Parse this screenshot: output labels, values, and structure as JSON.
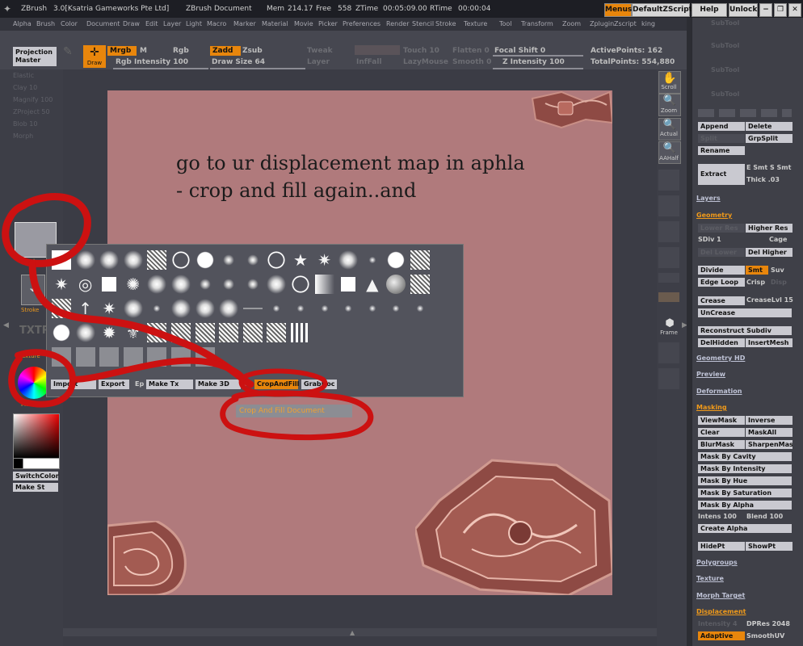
{
  "titlebar": {
    "app": "ZBrush",
    "version": "3.0[Ksatria Gameworks Pte Ltd]",
    "doc": "ZBrush Document",
    "mem_label": "Mem",
    "mem": "214.17",
    "free_label": "Free",
    "free": "558",
    "ztime_label": "ZTime",
    "ztime": "00:05:09.00",
    "rtime_label": "RTime",
    "rtime": "00:00:04",
    "menus": "Menus",
    "default_zscript": "DefaultZScript",
    "help": "Help",
    "unlock": "Unlock"
  },
  "menubar": [
    "Alpha",
    "Brush",
    "Color",
    "Document",
    "Draw",
    "Edit",
    "Layer",
    "Light",
    "Macro",
    "Marker",
    "Material",
    "Movie",
    "Picker",
    "Preferences",
    "Render",
    "Stencil",
    "Stroke",
    "Texture",
    "Tool",
    "Transform",
    "Zoom",
    "Zplugin",
    "Zscript",
    "king"
  ],
  "toolbar": {
    "projection_master": "Projection Master",
    "draw": "Draw",
    "mrgb": "Mrgb",
    "m": "M",
    "rgb": "Rgb",
    "rgb_intensity": "Rgb Intensity 100",
    "zadd": "Zadd",
    "zsub": "Zsub",
    "draw_size": "Draw Size 64",
    "focal_shift": "Focal Shift 0",
    "z_intensity": "Z Intensity 100",
    "active_points": "ActivePoints: 162",
    "total_points": "TotalPoints: 554,880",
    "dim1": "Tweak",
    "dim2": "Layer",
    "dim3": "InfFall",
    "dim4": "Touch 10",
    "dim5": "LazyMouse",
    "dim6": "Flatten 0",
    "dim7": "Smooth 0"
  },
  "left_shelf": {
    "sliders": [
      "Elastic",
      "Clay 10",
      "Magnify 100",
      "ZProject 50",
      "Blob 10",
      "Morph"
    ],
    "alpha_label": "Alpha",
    "stroke_label": "Stroke",
    "texture_label": "Texture",
    "material_label": "Material",
    "switch_color": "SwitchColor",
    "make_st": "Make St"
  },
  "canvas": {
    "line1": "go to ur displacement map in aphla",
    "line2": "- crop and fill again..and"
  },
  "alpha_popup": {
    "buttons": [
      "Import",
      "Export",
      "Ep",
      "Make Tx",
      "Make 3D",
      "Cc",
      "CropAndFill",
      "GrabDoc"
    ],
    "tooltip": "Crop And Fill Document"
  },
  "right_shelf": [
    "Scroll",
    "Zoom",
    "Actual",
    "AAHalf",
    "Frame"
  ],
  "tray": {
    "subtool_dim": [
      "SubTool",
      "SubTool",
      "SubTool",
      "SubTool"
    ],
    "append": "Append",
    "delete": "Delete",
    "split": "Split",
    "grpsplit": "GrpSplit",
    "rename": "Rename",
    "extract": "Extract",
    "e_smt": "E Smt S Smt",
    "thick": "Thick .03",
    "layers": "Layers",
    "geometry": "Geometry",
    "lower_res": "Lower Res",
    "higher_res": "Higher Res",
    "sdiv": "SDiv 1",
    "cage": "Cage",
    "del_lower": "Del Lower",
    "del_higher": "Del Higher",
    "divide": "Divide",
    "smt": "Smt",
    "suv": "Suv",
    "edge_loop": "Edge Loop",
    "crisp": "Crisp",
    "disp": "Disp",
    "crease": "Crease",
    "crease_lvl": "CreaseLvl 15",
    "uncrease": "UnCrease",
    "reconstruct": "Reconstruct Subdiv",
    "delhidden": "DelHidden",
    "insertmesh": "InsertMesh",
    "geometry_hd": "Geometry HD",
    "preview": "Preview",
    "deformation": "Deformation",
    "masking": "Masking",
    "viewmask": "ViewMask",
    "inverse": "Inverse",
    "clear": "Clear",
    "maskall": "MaskAll",
    "blurmask": "BlurMask",
    "sharpenmask": "SharpenMask",
    "mask_cavity": "Mask By Cavity",
    "mask_intensity": "Mask By Intensity",
    "mask_hue": "Mask By Hue",
    "mask_saturation": "Mask By Saturation",
    "mask_alpha": "Mask By Alpha",
    "intens": "Intens 100",
    "blend": "Blend 100",
    "create_alpha": "Create Alpha",
    "hidept": "HidePt",
    "showpt": "ShowPt",
    "polygroups": "Polygroups",
    "texture": "Texture",
    "morph_target": "Morph Target",
    "displacement": "Displacement",
    "intensity": "Intensity 4",
    "dpres": "DPRes 2048",
    "adaptive": "Adaptive",
    "smoothuv": "SmoothUV"
  },
  "colors": {
    "accent_orange": "#e8860c",
    "canvas_bg": "#b07a7c",
    "annotation_red": "#cc1111"
  }
}
